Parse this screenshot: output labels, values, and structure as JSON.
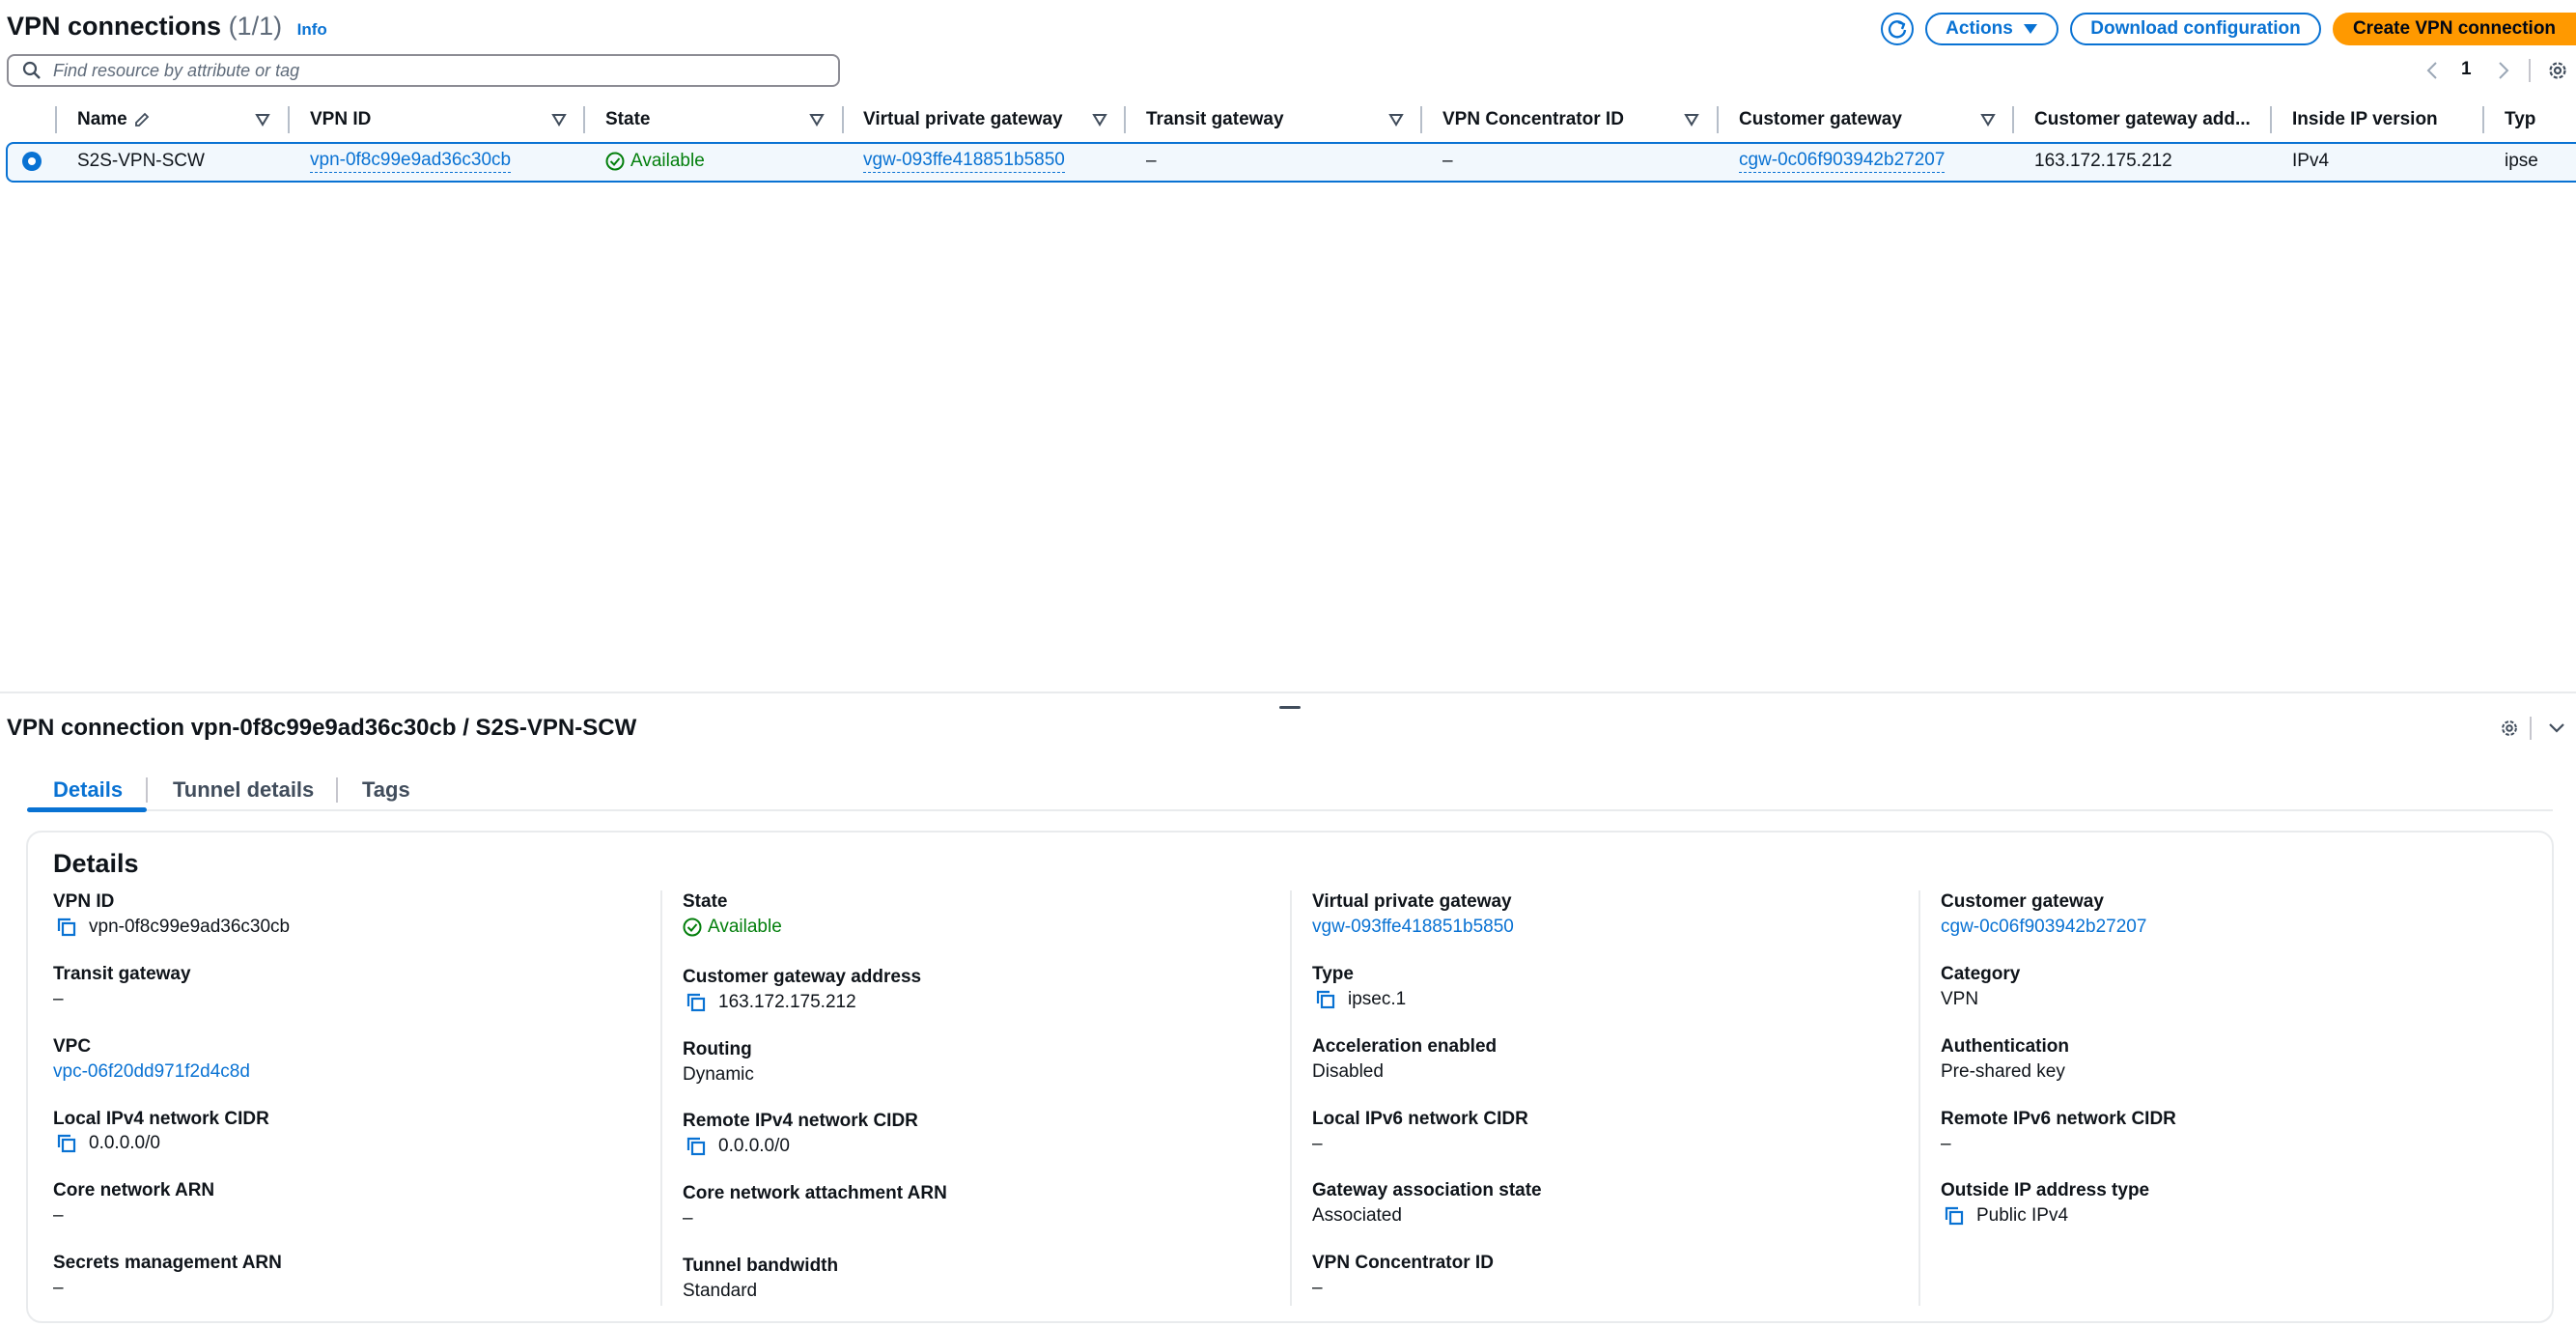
{
  "header": {
    "title": "VPN connections",
    "count": "(1/1)",
    "info": "Info",
    "actions_label": "Actions",
    "download_label": "Download configuration",
    "create_label": "Create VPN connection"
  },
  "search": {
    "placeholder": "Find resource by attribute or tag",
    "value": ""
  },
  "pagination": {
    "page": "1"
  },
  "table": {
    "columns": [
      "Name",
      "VPN ID",
      "State",
      "Virtual private gateway",
      "Transit gateway",
      "VPN Concentrator ID",
      "Customer gateway",
      "Customer gateway add...",
      "Inside IP version",
      "Typ"
    ],
    "row": {
      "name": "S2S-VPN-SCW",
      "vpn_id": "vpn-0f8c99e9ad36c30cb",
      "state": "Available",
      "vgw": "vgw-093ffe418851b5850",
      "transit_gateway": "–",
      "concentrator": "–",
      "cgw": "cgw-0c06f903942b27207",
      "cgw_address": "163.172.175.212",
      "inside_ip": "IPv4",
      "type": "ipse"
    }
  },
  "panel": {
    "title": "VPN connection vpn-0f8c99e9ad36c30cb / S2S-VPN-SCW",
    "tabs": [
      "Details",
      "Tunnel details",
      "Tags"
    ],
    "card_title": "Details",
    "col1": {
      "vpn_id_label": "VPN ID",
      "vpn_id": "vpn-0f8c99e9ad36c30cb",
      "transit_label": "Transit gateway",
      "transit": "–",
      "vpc_label": "VPC",
      "vpc": "vpc-06f20dd971f2d4c8d",
      "local_v4_label": "Local IPv4 network CIDR",
      "local_v4": "0.0.0.0/0",
      "core_arn_label": "Core network ARN",
      "core_arn": "–",
      "secrets_label": "Secrets management ARN",
      "secrets": "–"
    },
    "col2": {
      "state_label": "State",
      "state": "Available",
      "cgw_addr_label": "Customer gateway address",
      "cgw_addr": "163.172.175.212",
      "routing_label": "Routing",
      "routing": "Dynamic",
      "remote_v4_label": "Remote IPv4 network CIDR",
      "remote_v4": "0.0.0.0/0",
      "core_attach_label": "Core network attachment ARN",
      "core_attach": "–",
      "bandwidth_label": "Tunnel bandwidth",
      "bandwidth": "Standard"
    },
    "col3": {
      "vgw_label": "Virtual private gateway",
      "vgw": "vgw-093ffe418851b5850",
      "type_label": "Type",
      "type": "ipsec.1",
      "accel_label": "Acceleration enabled",
      "accel": "Disabled",
      "local_v6_label": "Local IPv6 network CIDR",
      "local_v6": "–",
      "assoc_label": "Gateway association state",
      "assoc": "Associated",
      "concentrator_label": "VPN Concentrator ID",
      "concentrator": "–"
    },
    "col4": {
      "cgw_label": "Customer gateway",
      "cgw": "cgw-0c06f903942b27207",
      "category_label": "Category",
      "category": "VPN",
      "auth_label": "Authentication",
      "auth": "Pre-shared key",
      "remote_v6_label": "Remote IPv6 network CIDR",
      "remote_v6": "–",
      "outside_label": "Outside IP address type",
      "outside": "Public IPv4"
    }
  },
  "colors": {
    "link": "#0972d3",
    "primary": "#ff9900",
    "success": "#037f0c",
    "text": "#0f141a"
  }
}
